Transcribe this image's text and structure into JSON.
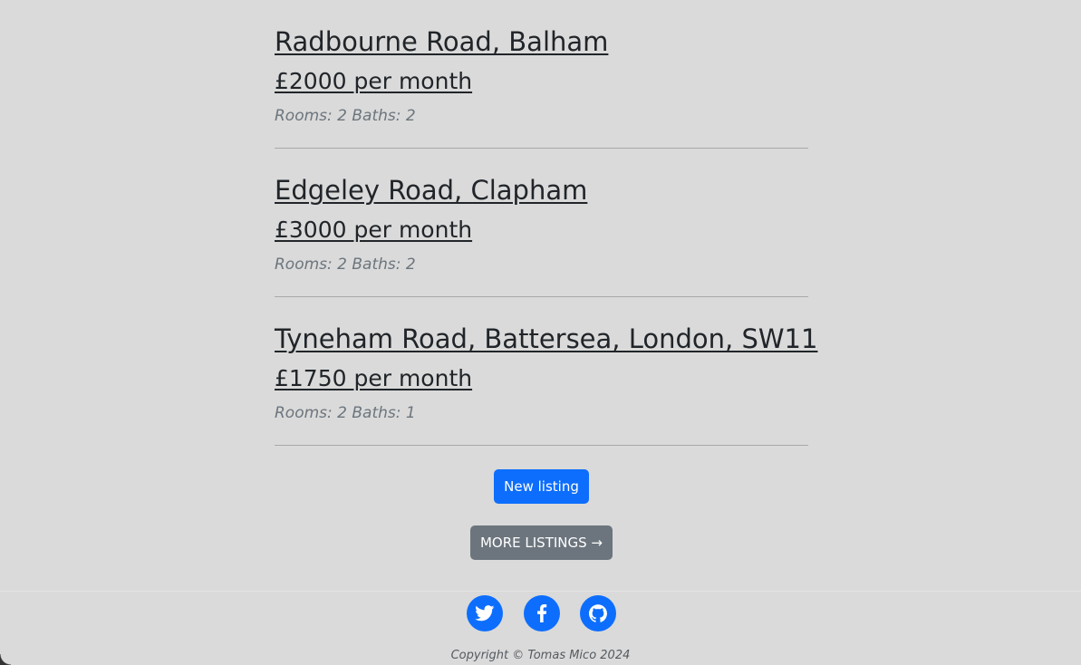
{
  "listings": [
    {
      "title": "Radbourne Road, Balham",
      "price": "£2000 per month",
      "meta": "Rooms: 2 Baths: 2"
    },
    {
      "title": "Edgeley Road, Clapham",
      "price": "£3000 per month",
      "meta": "Rooms: 2 Baths: 2"
    },
    {
      "title": "Tyneham Road, Battersea, London, SW11",
      "price": "£1750 per month",
      "meta": "Rooms: 2 Baths: 1"
    }
  ],
  "actions": {
    "new_listing_label": "New listing",
    "more_listings_label": "MORE LISTINGS →"
  },
  "footer": {
    "social_icons": [
      "twitter-icon",
      "facebook-icon",
      "github-icon"
    ],
    "copyright": "Copyright © Tomas Mico 2024"
  },
  "colors": {
    "background": "#dadada",
    "primary": "#0d6efd",
    "secondary": "#6c757d",
    "text": "#212529",
    "muted": "#6c757d"
  }
}
